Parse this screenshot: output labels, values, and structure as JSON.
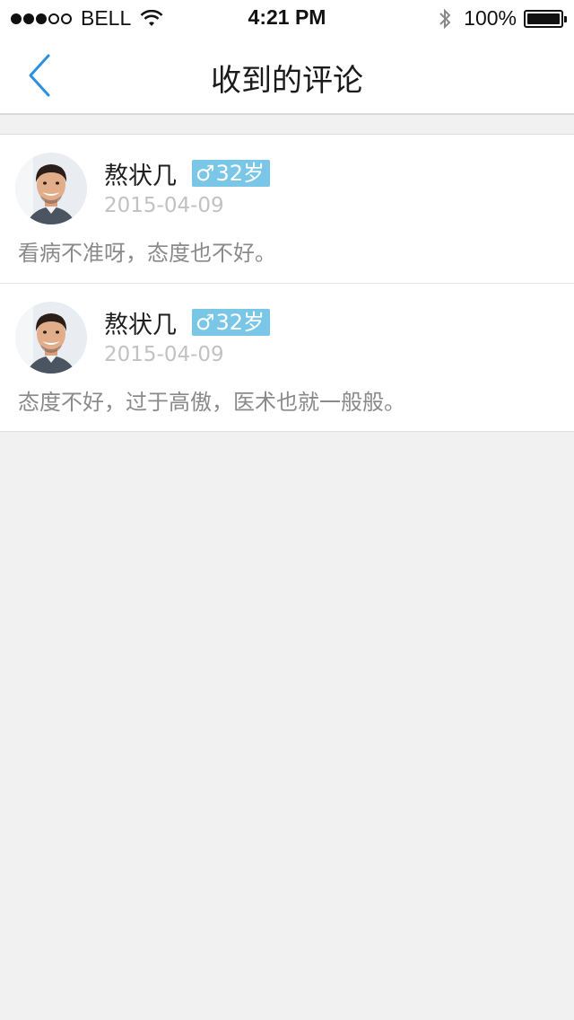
{
  "status_bar": {
    "carrier": "BELL",
    "time": "4:21 PM",
    "battery": "100%",
    "signal_bars_filled": 3,
    "signal_bars_total": 5
  },
  "nav": {
    "back_icon": "chevron-left-icon",
    "title": "收到的评论",
    "accent_color": "#2d8fe0"
  },
  "comments": [
    {
      "username": "熬状几",
      "gender_symbol": "♂",
      "age": "32岁",
      "date": "2015-04-09",
      "text": "看病不准呀，态度也不好。"
    },
    {
      "username": "熬状几",
      "gender_symbol": "♂",
      "age": "32岁",
      "date": "2015-04-09",
      "text": "态度不好，过于高傲，医术也就一般般。"
    }
  ],
  "colors": {
    "badge": "#79c6e6",
    "background": "#f1f1f1",
    "date": "#c2c2c2",
    "comment_text": "#8a8a8a"
  }
}
